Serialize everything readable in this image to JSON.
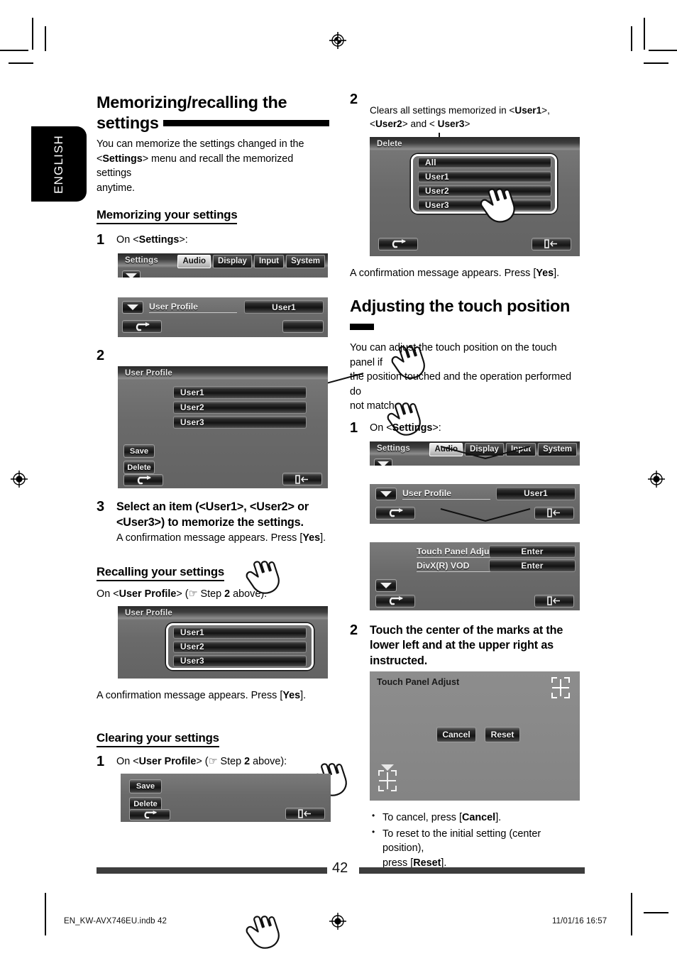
{
  "page": {
    "language_tab": "ENGLISH",
    "page_number": "42",
    "imprint_file": "EN_KW-AVX746EU.indb   42",
    "imprint_date": "11/01/16   16:57"
  },
  "left_column": {
    "section_title_line1": "Memorizing/recalling the",
    "section_title_line2": "settings",
    "intro_1": "You can memorize the settings changed in the",
    "intro_2_pre": "<",
    "intro_2_bold": "Settings",
    "intro_2_post": "> menu and recall the memorized settings",
    "intro_3": "anytime.",
    "subhead_memorizing": "Memorizing your settings",
    "step1_num": "1",
    "step1_lead_pre": "On <",
    "step1_lead_bold": "Settings",
    "step1_lead_post": ">:",
    "step2_num": "2",
    "step3_num": "3",
    "step3_text_line1": "Select an item (<User1>, <User2> or",
    "step3_text_line2": "<User3>) to memorize the settings.",
    "step3_sub_pre": "A confirmation message appears. Press [",
    "step3_sub_bold": "Yes",
    "step3_sub_post": "].",
    "subhead_recalling": "Recalling your settings",
    "recall_lead_pre": "On <",
    "recall_lead_bold": "User Profile",
    "recall_lead_mid": "> (☞ Step ",
    "recall_lead_stepnum": "2",
    "recall_lead_post": " above):",
    "recall_note_pre": "A confirmation message appears. Press [",
    "recall_note_bold": "Yes",
    "recall_note_post": "].",
    "subhead_clearing": "Clearing your settings",
    "clear_step1_num": "1",
    "clear_lead_pre": "On <",
    "clear_lead_bold": "User Profile",
    "clear_lead_mid": "> (☞ Step ",
    "clear_lead_stepnum": "2",
    "clear_lead_post": " above):"
  },
  "right_column": {
    "step2_num": "2",
    "callout_line1_pre": "Clears all settings memorized in <",
    "callout_line1_bold": "User1",
    "callout_line1_post": ">,",
    "callout_line2_pre": "<",
    "callout_line2_bold1": "User2",
    "callout_line2_mid": "> and < ",
    "callout_line2_bold2": "User3",
    "callout_line2_post": ">",
    "delete_note_pre": "A confirmation message appears. Press [",
    "delete_note_bold": "Yes",
    "delete_note_post": "].",
    "section_title": "Adjusting the touch position",
    "intro_1": "You can adjust the touch position on the touch panel if",
    "intro_2": "the position touched and the operation performed do",
    "intro_3": "not match.",
    "step1_num": "1",
    "step1_lead_pre": "On <",
    "step1_lead_bold": "Settings",
    "step1_lead_post": ">:",
    "step2b_num": "2",
    "step2b_line1": "Touch the center of the marks at the",
    "step2b_line2": "lower left and at the upper right as",
    "step2b_line3": "instructed.",
    "bullet1_pre": "To cancel, press [",
    "bullet1_bold": "Cancel",
    "bullet1_post": "].",
    "bullet2_line1": "To reset to the initial setting (center position),",
    "bullet2_pre": "press [",
    "bullet2_bold": "Reset",
    "bullet2_post": "]."
  },
  "screens": {
    "settings_bar": {
      "title": "Settings",
      "tabs": [
        "Audio",
        "Display",
        "Input",
        "System"
      ],
      "selected_tab": "Audio"
    },
    "user_profile_row": {
      "label": "User Profile",
      "value_button": "User1"
    },
    "user_profile_full": {
      "title": "User Profile",
      "items": [
        "User1",
        "User2",
        "User3"
      ],
      "save_label": "Save",
      "delete_label": "Delete"
    },
    "user_profile_recall": {
      "title": "User Profile",
      "items": [
        "User1",
        "User2",
        "User3"
      ]
    },
    "user_profile_clear": {
      "save_label": "Save",
      "delete_label": "Delete"
    },
    "delete_screen": {
      "title": "Delete",
      "items": [
        "All",
        "User1",
        "User2",
        "User3"
      ]
    },
    "touch_menu": {
      "row1_label": "Touch Panel Adjust",
      "row1_button": "Enter",
      "row2_label": "DivX(R) VOD",
      "row2_button": "Enter"
    },
    "touch_panel_adjust": {
      "title": "Touch Panel Adjust",
      "cancel_label": "Cancel",
      "reset_label": "Reset"
    }
  },
  "colors": {
    "screen_bg": "#6e6e6e",
    "title_dark": "#2b2b2b",
    "button_dark": "#151515",
    "rule": "#3d3d3d",
    "accent_white": "#ffffff"
  }
}
